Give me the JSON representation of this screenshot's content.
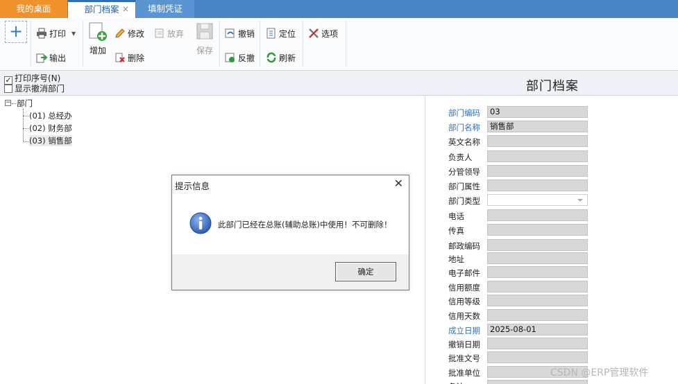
{
  "tabs": [
    {
      "label": "我的桌面"
    },
    {
      "label": "部门档案"
    },
    {
      "label": "填制凭证"
    }
  ],
  "tab_close_glyph": "×",
  "toolbar": {
    "print": "打印",
    "export": "输出",
    "add": "增加",
    "modify": "修改",
    "delete": "删除",
    "abandon": "放弃",
    "save": "保存",
    "undo": "撤销",
    "reverse": "反撤",
    "locate": "定位",
    "refresh": "刷新",
    "options": "选项",
    "new_glyph": "+"
  },
  "options": {
    "print_seq": {
      "label": "打印序号(N)",
      "checked": true
    },
    "show_cancelled": {
      "label": "显示撤消部门",
      "checked": false
    }
  },
  "page_title": "部门档案",
  "tree": {
    "root": "部门",
    "children": [
      "(01) 总经办",
      "(02) 财务部",
      "(03) 销售部"
    ]
  },
  "form": {
    "fields": [
      {
        "label": "部门编码",
        "value": "03",
        "required": true
      },
      {
        "label": "部门名称",
        "value": "销售部",
        "required": true
      },
      {
        "label": "英文名称",
        "value": "",
        "required": false
      },
      {
        "label": "负责人",
        "value": "",
        "required": false
      },
      {
        "label": "分管领导",
        "value": "",
        "required": false
      },
      {
        "label": "部门属性",
        "value": "",
        "required": false
      },
      {
        "label": "部门类型",
        "value": "",
        "required": false
      },
      {
        "label": "电话",
        "value": "",
        "required": false
      },
      {
        "label": "传真",
        "value": "",
        "required": false
      },
      {
        "label": "邮政编码",
        "value": "",
        "required": false
      },
      {
        "label": "地址",
        "value": "",
        "required": false
      },
      {
        "label": "电子邮件",
        "value": "",
        "required": false
      },
      {
        "label": "信用额度",
        "value": "",
        "required": false
      },
      {
        "label": "信用等级",
        "value": "",
        "required": false
      },
      {
        "label": "信用天数",
        "value": "",
        "required": false
      },
      {
        "label": "成立日期",
        "value": "2025-08-01",
        "required": true
      },
      {
        "label": "撤销日期",
        "value": "",
        "required": false
      },
      {
        "label": "批准文号",
        "value": "",
        "required": false
      },
      {
        "label": "批准单位",
        "value": "",
        "required": false
      },
      {
        "label": "备注",
        "value": "",
        "required": false
      }
    ]
  },
  "dialog": {
    "title": "提示信息",
    "message": "此部门已经在总账(辅助总账)中使用！不可删除！",
    "ok_label": "确定",
    "close_glyph": "✕"
  },
  "watermark": "CSDN @ERP管理软件",
  "colors": {
    "tabbar": "#4a86c5",
    "home_tab": "#f0912c",
    "required_label": "#2e6fc0",
    "info_icon": "#2d5fb3"
  }
}
